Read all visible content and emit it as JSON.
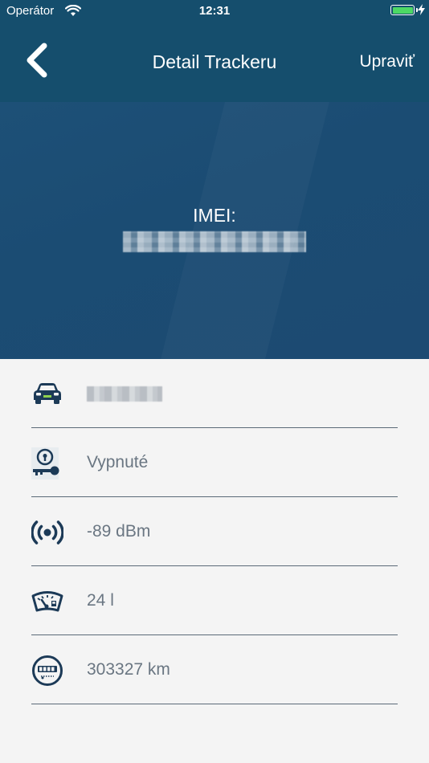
{
  "status_bar": {
    "carrier": "Operátor",
    "time": "12:31"
  },
  "nav": {
    "title": "Detail Trackeru",
    "edit_label": "Upraviť"
  },
  "hero": {
    "imei_label": "IMEI:"
  },
  "details": [
    {
      "icon": "car-icon",
      "value": ""
    },
    {
      "icon": "ignition-key-icon",
      "value": "Vypnuté"
    },
    {
      "icon": "signal-icon",
      "value": "-89 dBm"
    },
    {
      "icon": "fuel-gauge-icon",
      "value": "24 l"
    },
    {
      "icon": "odometer-icon",
      "value": "303327 km"
    }
  ],
  "colors": {
    "header": "#154e6d",
    "hero": "#1c4a72",
    "icon": "#1c3a57",
    "text": "#6a7682",
    "battery": "#4cd964"
  }
}
